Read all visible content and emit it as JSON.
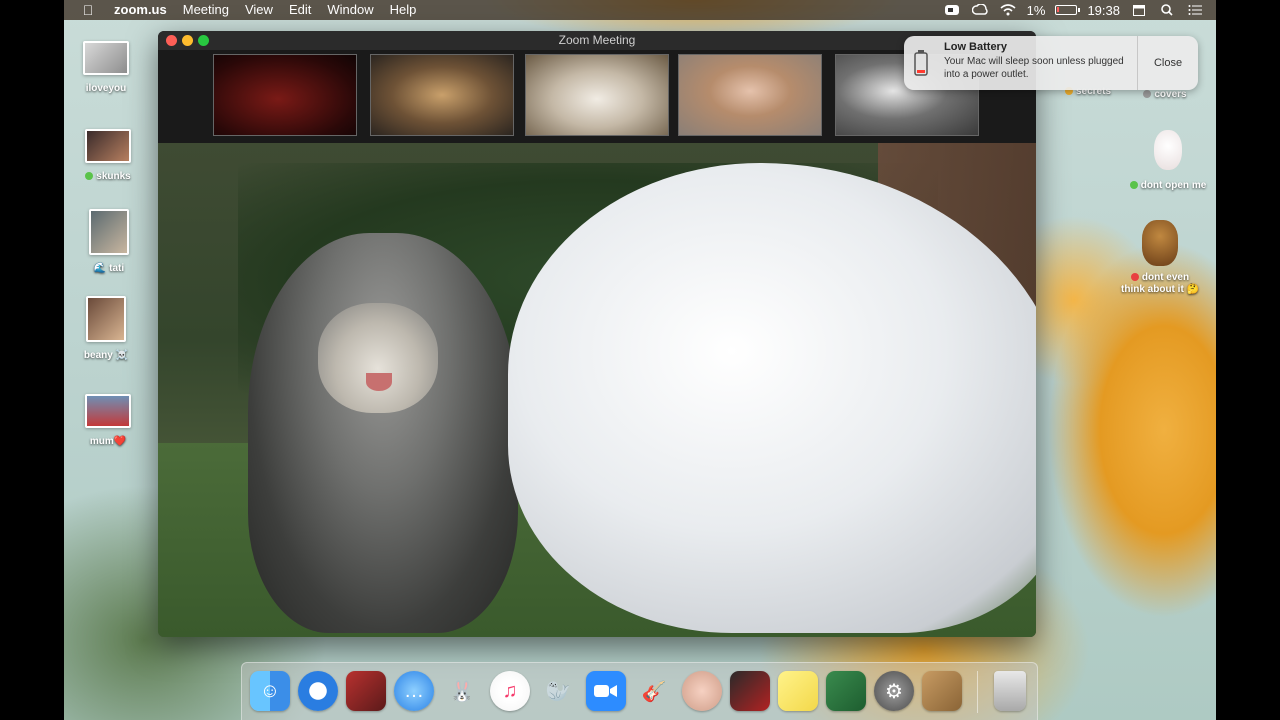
{
  "menubar": {
    "app_name": "zoom.us",
    "items": [
      "Meeting",
      "View",
      "Edit",
      "Window",
      "Help"
    ],
    "battery_percent": "1%",
    "time": "19:38"
  },
  "desktop_icons_left": [
    {
      "label": "iloveyou"
    },
    {
      "label": "skunks",
      "dot_color": "#5ac34a"
    },
    {
      "label": "tati",
      "prefix": "🌊"
    },
    {
      "label": "beany ☠️"
    },
    {
      "label": "mum❤️"
    }
  ],
  "desktop_icons_right": [
    {
      "label": "secrets",
      "dot_color": "#f0b030"
    },
    {
      "label": "covers",
      "dot_color": "#9a9a9a"
    },
    {
      "label": "dont open me",
      "dot_color": "#5ac34a"
    },
    {
      "label_line1": "dont even",
      "label_line2": "think about it 🤔",
      "dot_color": "#e84040"
    }
  ],
  "zoom": {
    "window_title": "Zoom Meeting",
    "participants": [
      "participant-1",
      "participant-2",
      "participant-3",
      "participant-4",
      "participant-5"
    ]
  },
  "notification": {
    "title": "Low Battery",
    "message": "Your Mac will sleep soon unless plugged into a power outlet.",
    "close_label": "Close"
  },
  "dock": {
    "apps": [
      "finder-icon",
      "safari-icon",
      "photo-booth-icon",
      "messages-icon",
      "launchpad-icon",
      "music-icon",
      "preview-icon",
      "zoom-icon",
      "garageband-icon",
      "memoji-icon",
      "photo-slideshow-icon",
      "stickies-icon",
      "image-capture-icon",
      "system-preferences-icon",
      "documents-icon",
      "trash-icon"
    ]
  }
}
